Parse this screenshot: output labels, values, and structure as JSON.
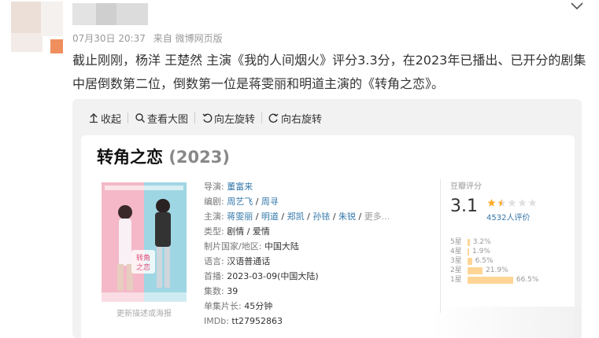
{
  "post": {
    "meta": {
      "time": "07月30日 20:37",
      "source": "来自 微博网页版"
    },
    "text": "截止刚刚，杨洋 王楚然 主演《我的人间烟火》评分3.3分，在2023年已播出、已开分的剧集中居倒数第二位，倒数第一位是蒋雯丽和明道主演的《转角之恋》。"
  },
  "toolbar": {
    "collapse_label": "收起",
    "view_large_label": "查看大图",
    "rotate_left_label": "向左旋转",
    "rotate_right_label": "向右旋转"
  },
  "movie": {
    "title": "转角之恋",
    "year": "(2023)",
    "poster_caption": "更新描述或海报",
    "director_label": "导演:",
    "director": "董富来",
    "writer_label": "编剧:",
    "writer_1": "周艺飞",
    "writer_2": "周寻",
    "cast_label": "主演:",
    "cast": [
      "蒋雯丽",
      "明道",
      "郑凯",
      "孙铱",
      "朱锐"
    ],
    "cast_more": "更多...",
    "sep": " / ",
    "genre_label": "类型:",
    "genre": "剧情 / 爱情",
    "region_label": "制片国家/地区:",
    "region": "中国大陆",
    "language_label": "语言:",
    "language": "汉语普通话",
    "premiere_label": "首播:",
    "premiere": "2023-03-09(中国大陆)",
    "episodes_label": "集数:",
    "episodes": "39",
    "runtime_label": "单集片长:",
    "runtime": "45分钟",
    "imdb_label": "IMDb:",
    "imdb": "tt27952863"
  },
  "rating": {
    "title": "豆瓣评分",
    "score": "3.1",
    "stars_value": 1.5,
    "stars_max": 5,
    "count": "4532人评价",
    "colors": {
      "star": "#ffac2d",
      "bar": "#ffd596"
    },
    "distribution": [
      {
        "label": "5星",
        "pct_text": "3.2%",
        "pct": 3.2
      },
      {
        "label": "4星",
        "pct_text": "1.9%",
        "pct": 1.9
      },
      {
        "label": "3星",
        "pct_text": "6.5%",
        "pct": 6.5
      },
      {
        "label": "2星",
        "pct_text": "21.9%",
        "pct": 21.9
      },
      {
        "label": "1星",
        "pct_text": "66.5%",
        "pct": 66.5
      }
    ]
  }
}
